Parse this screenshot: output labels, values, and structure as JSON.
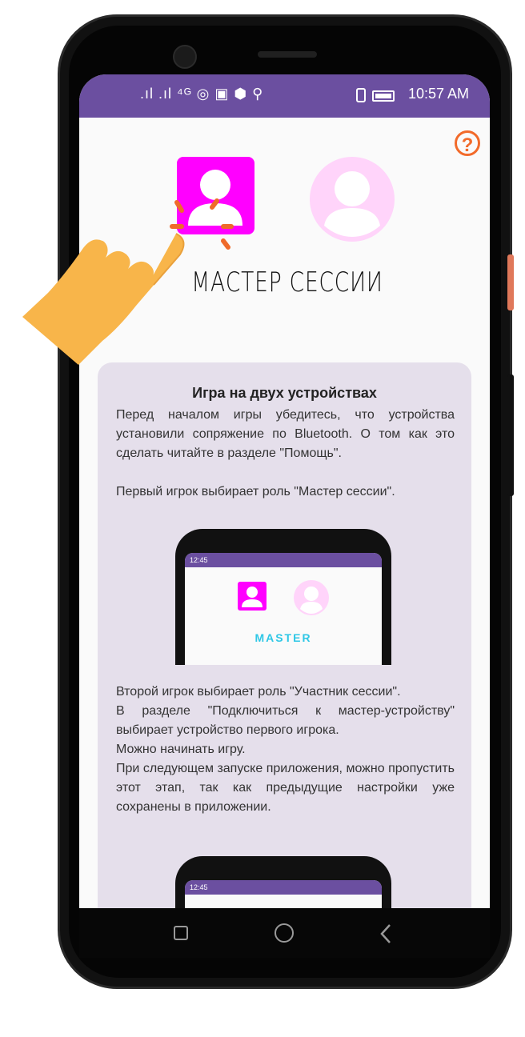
{
  "status_bar": {
    "left_icons": ".ıl .ıl ⁴ᴳ ◎ ▣ ⬢ ⚲",
    "time": "10:57 AM",
    "right_icons": "⎕ ▭"
  },
  "help_button": {
    "label": "?"
  },
  "roles": {
    "title": "МАСТЕР СЕССИИ"
  },
  "card": {
    "heading": "Игра на двух устройствах",
    "para1": "Перед началом игры убедитесь, что устройства установили сопряжение по Bluetooth. О том как это сделать читайте в разделе \"Помощь\".",
    "para2": "Первый игрок выбирает роль \"Мастер сессии\".",
    "para3_lines": [
      "Второй игрок выбирает роль \"Участник сессии\".",
      "В разделе \"Подключиться к мастер-устройству\" выбирает устройство первого игрока.",
      "Можно начинать игру.",
      "При следующем запуске приложения, можно пропустить этот этап, так как предыдущие настройки уже сохранены в приложении."
    ],
    "screenshot1": {
      "time": "12:45",
      "label": "MASTER"
    },
    "screenshot2": {
      "time": "12:45"
    }
  },
  "nav": {
    "back": "back",
    "home": "home",
    "recents": "recents"
  },
  "colors": {
    "accent": "#6b4fa0",
    "master": "#ff00ff",
    "participant": "#ffd4fa",
    "help": "#f26a2a",
    "hand": "#f8b54a"
  }
}
